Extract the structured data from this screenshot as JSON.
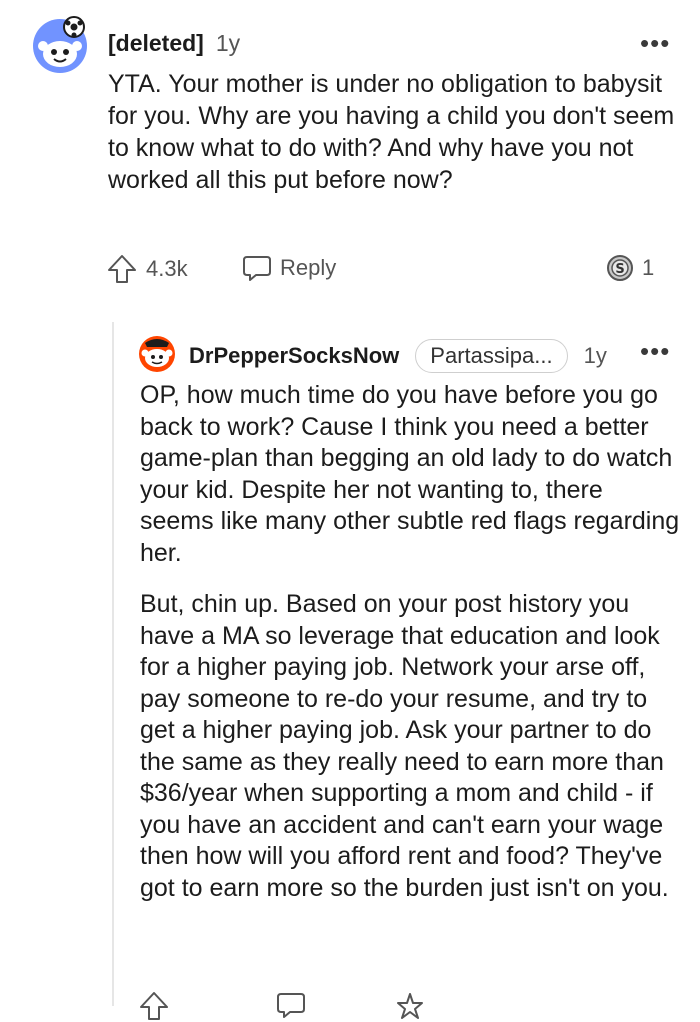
{
  "comment": {
    "author": "[deleted]",
    "age": "1y",
    "body": "YTA. Your mother is under no obligation to babysit for you. Why are you having a child you don't seem to know what to do with? And why have you not worked all this put before now?",
    "upvotes": "4.3k",
    "reply_label": "Reply",
    "award_count": "1",
    "more_label": "•••"
  },
  "reply": {
    "author": "DrPepperSocksNow",
    "flair": "Partassipa...",
    "age": "1y",
    "more_label": "•••",
    "paragraphs": [
      "OP, how much time do you have before you go back to work? Cause I think you need a better game-plan than begging an old lady to do watch your kid. Despite her not wanting to, there seems like many other subtle red flags regarding her.",
      "But, chin up. Based on your post history you have a MA so leverage that education and look for a higher paying job. Network your arse off, pay someone to re-do your resume, and try to get a higher paying job. Ask your partner to do the same as they really need to earn more than $36/year when supporting a mom and child - if you have an accident and can't earn your wage then how will you afford rent and food? They've got to earn more so the burden just isn't on you."
    ]
  },
  "icons": {
    "avatar": "reddit-snoo-avatar-icon",
    "upvote": "upvote-arrow-icon",
    "reply": "speech-bubble-icon",
    "award": "silver-award-icon",
    "more": "ellipsis-icon"
  },
  "colors": {
    "avatar_bg": "#7193FF",
    "reply_avatar_bg": "#FF4500",
    "text": "#1C1C1C",
    "meta": "#555555"
  }
}
